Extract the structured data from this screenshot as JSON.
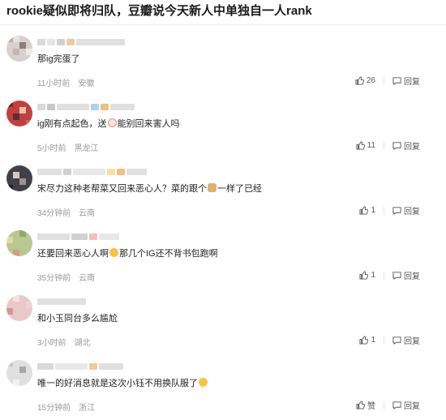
{
  "title": "rookie疑似即将归队，豆瓣说今天新人中单独自一人rank",
  "icons": {
    "like": "thumbs-up-icon",
    "reply": "reply-icon"
  },
  "comments": [
    {
      "text": "那ig完蛋了",
      "time": "11小时前",
      "location": "安徽",
      "likes": "26",
      "reply": "回复"
    },
    {
      "text_a": "ig刚有点起色，送",
      "text_b": "能别回来害人吗",
      "time": "5小时前",
      "location": "黑龙江",
      "likes": "11",
      "reply": "回复"
    },
    {
      "text_a": "宋尽力这种老帮菜又回来恶心人？菜的跟个",
      "text_b": "一样了已经",
      "time": "34分钟前",
      "location": "云南",
      "likes": "1",
      "reply": "回复"
    },
    {
      "text_a": "还要回来恶心人啊",
      "text_b": "那几个IG还不背书包跑啊",
      "time": "35分钟前",
      "location": "云南",
      "likes": "1",
      "reply": "回复"
    },
    {
      "text": "和小玉同台多么尴尬",
      "time": "3小时前",
      "location": "湖北",
      "likes": "1",
      "reply": "回复"
    },
    {
      "text_a": "唯一的好消息就是这次小钰不用换队服了",
      "time": "15分钟前",
      "location": "浙江",
      "likes": "赞",
      "reply": "回复"
    }
  ]
}
